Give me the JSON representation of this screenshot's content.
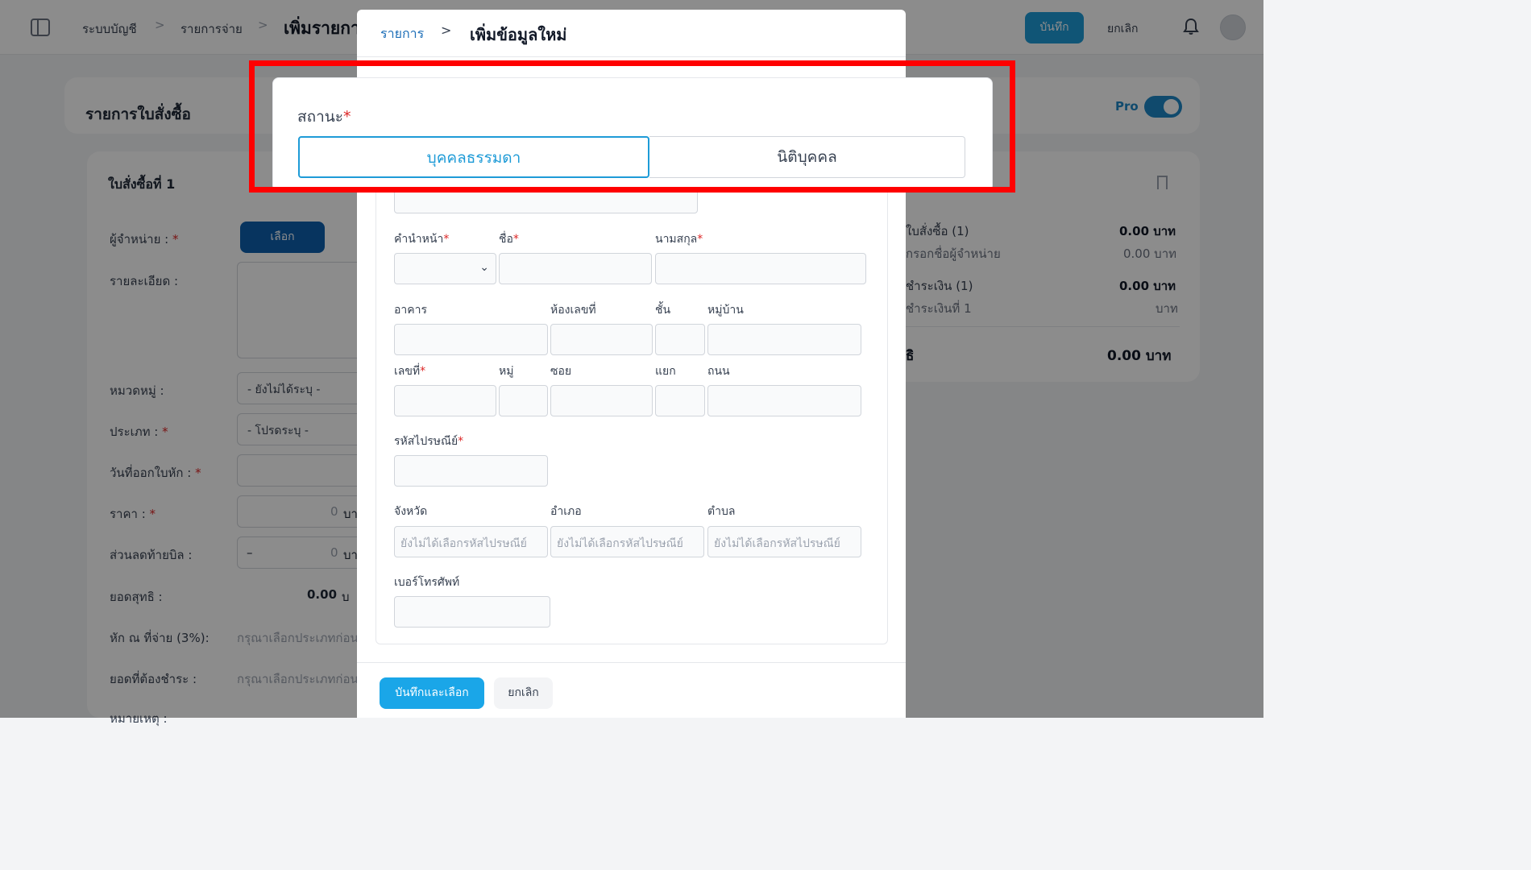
{
  "topbar": {
    "breadcrumb": [
      "ระบบบัญชี",
      "รายการจ่าย"
    ],
    "separator": ">",
    "title": "เพิ่มรายการ",
    "save_label": "บันทึก",
    "cancel_label": "ยกเลิก"
  },
  "page": {
    "list_title": "รายการใบสั่งซื้อ",
    "pro_label": "Pro",
    "pro_enabled": true,
    "po_title": "ใบสั่งซื้อที่ 1",
    "fields": {
      "vendor": "ผู้จำหน่าย :",
      "details": "รายละเอียด :",
      "category": "หมวดหมู่ :",
      "type": "ประเภท :",
      "wht_date": "วันที่ออกใบหัก :",
      "price": "ราคา :",
      "discount": "ส่วนลดท้ายบิล :",
      "net": "ยอดสุทธิ :",
      "wht": "หัก ณ ที่จ่าย (3%):",
      "due": "ยอดที่ต้องชำระ :",
      "note": "หมายเหตุ :"
    },
    "choose_label": "เลือก",
    "category_value": "- ยังไม่ได้ระบุ -",
    "type_value": "- โปรดระบุ -",
    "price_value": "0",
    "price_unit": "บา",
    "discount_prefix": "–",
    "discount_value": "0",
    "net_value": "0.00",
    "net_unit": "บ",
    "select_type_hint": "กรุณาเลือกประเภทก่อน"
  },
  "summary": {
    "po_count_label": "ใบสั่งซื้อ (1)",
    "po_count_value": "0.00 บาท",
    "vendor_hint": "กรอกชื่อผู้จำหน่าย",
    "vendor_value": "0.00 บาท",
    "payment_label": "ชำระเงิน (1)",
    "payment_value": "0.00 บาท",
    "payment_item_label": "ชำระเงินที่ 1",
    "payment_item_unit": "บาท",
    "total_label": "ธิ",
    "total_value": "0.00 บาท"
  },
  "modal": {
    "breadcrumb": "รายการ",
    "separator": ">",
    "title": "เพิ่มข้อมูลใหม่",
    "status_label": "สถานะ",
    "status_options": [
      "บุคคลธรรมดา",
      "นิติบุคคล"
    ],
    "status_selected": "บุคคลธรรมดา",
    "labels": {
      "prefix": "คำนำหน้า",
      "first_name": "ชื่อ",
      "last_name": "นามสกุล",
      "building": "อาคาร",
      "room": "ห้องเลขที่",
      "floor": "ชั้น",
      "village": "หมู่บ้าน",
      "house_no": "เลขที่",
      "moo": "หมู่",
      "soi": "ซอย",
      "yaek": "แยก",
      "road": "ถนน",
      "postal_code": "รหัสไปรษณีย์",
      "province": "จังหวัด",
      "district": "อำเภอ",
      "subdistrict": "ตำบล",
      "phone": "เบอร์โทรศัพท์"
    },
    "placeholders": {
      "province": "ยังไม่ได้เลือกรหัสไปรษณีย์",
      "district": "ยังไม่ได้เลือกรหัสไปรษณีย์",
      "subdistrict": "ยังไม่ได้เลือกรหัสไปรษณีย์"
    },
    "required_mark": "*",
    "save_select_label": "บันทึกและเลือก",
    "cancel_label": "ยกเลิก"
  },
  "colors": {
    "accent": "#1e9bd7",
    "highlight": "#ff0000",
    "required": "#dc2626"
  },
  "icons": [
    "sidebar-toggle-icon",
    "chevron-right-icon",
    "bell-icon",
    "bookmark-icon",
    "chevron-down-icon"
  ]
}
